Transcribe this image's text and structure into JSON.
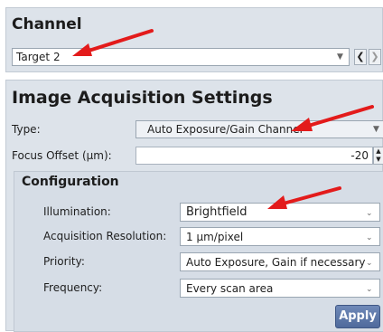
{
  "channel": {
    "title": "Channel",
    "selected": "Target 2"
  },
  "acquisition": {
    "title": "Image Acquisition Settings",
    "type_label": "Type:",
    "type_value": "Auto Exposure/Gain Channel",
    "focus_label": "Focus Offset (µm):",
    "focus_value": "-20"
  },
  "configuration": {
    "title": "Configuration",
    "rows": [
      {
        "label": "Illumination:",
        "value": "Brightfield"
      },
      {
        "label": "Acquisition Resolution:",
        "value": "1 µm/pixel"
      },
      {
        "label": "Priority:",
        "value": "Auto Exposure, Gain if necessary"
      },
      {
        "label": "Frequency:",
        "value": "Every scan area"
      }
    ],
    "apply_label": "Apply"
  },
  "icons": {
    "dropdown": "chevron-down-icon",
    "prev": "chevron-left-icon",
    "next": "chevron-right-icon",
    "spinner": "spin-up-down-icon",
    "annotation": "red-arrow-icon"
  },
  "colors": {
    "panel": "#dde3ea",
    "apply": "#4f6a9c",
    "annotation_arrow": "#e31b1b"
  }
}
